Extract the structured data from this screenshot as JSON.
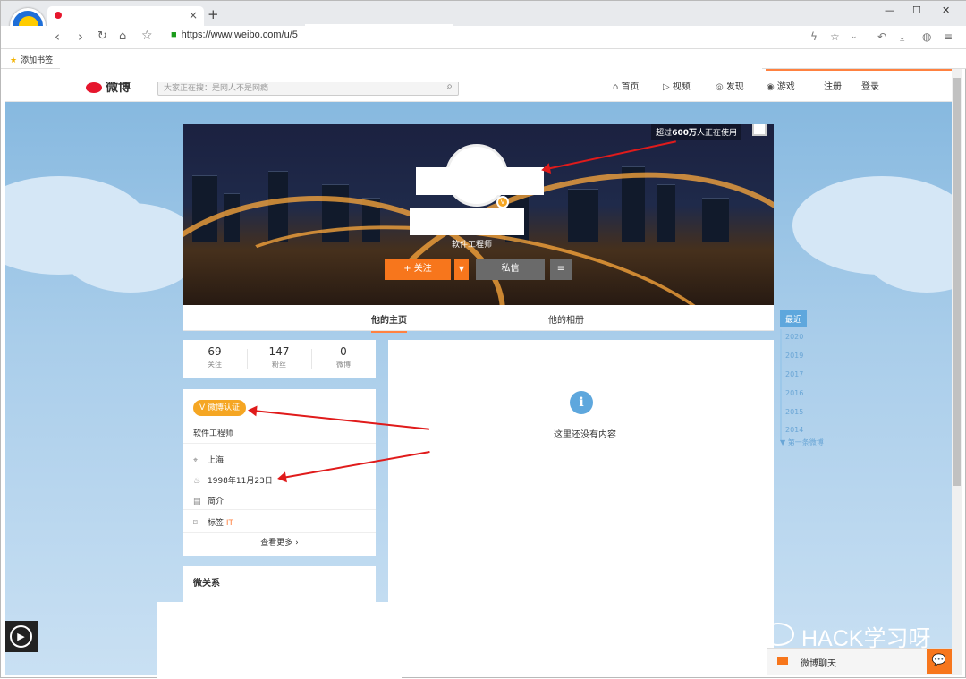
{
  "browser": {
    "url": "https://www.weibo.com/u/5",
    "new_tab_symbol": "+",
    "close_tab_symbol": "×",
    "bookmark_label": "添加书签",
    "window_controls": [
      "—",
      "☐",
      "✕"
    ]
  },
  "weibo_nav": {
    "logo_text": "微博",
    "search_placeholder": "大家正在搜：是网人不是网瘾",
    "links": [
      {
        "label": "首页",
        "icon": "home-icon"
      },
      {
        "label": "视频",
        "icon": "video-icon"
      },
      {
        "label": "发现",
        "icon": "discover-icon"
      },
      {
        "label": "游戏",
        "icon": "game-icon"
      }
    ],
    "register": "注册",
    "login": "登录"
  },
  "cover": {
    "user_count_prefix": "超过",
    "user_count_value": "600万",
    "user_count_suffix": "人正在使用",
    "occupation": "软件工程师",
    "follow_button": "+ 关注",
    "dropdown_symbol": "▼",
    "message_button": "私信",
    "menu_symbol": "≡",
    "verified_symbol": "v"
  },
  "tabs": {
    "home": "他的主页",
    "album": "他的相册"
  },
  "stats": [
    {
      "value": "69",
      "label": "关注"
    },
    {
      "value": "147",
      "label": "粉丝"
    },
    {
      "value": "0",
      "label": "微博"
    }
  ],
  "profile_info": {
    "verification_badge": "V 微博认证",
    "title": "软件工程师",
    "location": "上海",
    "birthday": "1998年11月23日",
    "bio_label": "简介:",
    "tags_label": "标签",
    "tags_value": "IT",
    "see_more": "查看更多 ›"
  },
  "relations": {
    "heading": "微关系"
  },
  "feed": {
    "empty_message": "这里还没有内容",
    "info_symbol": "i"
  },
  "timeline": {
    "current": "最近",
    "years": [
      "2020",
      "2019",
      "2017",
      "2016",
      "2015",
      "2014"
    ],
    "first_post": "▼ 第一条微博"
  },
  "chat": {
    "label": "微博聊天",
    "bubble_symbol": "💬"
  },
  "watermark": {
    "text": "HACK学习呀"
  },
  "colors": {
    "accent": "#ff8140",
    "follow": "#f7761c",
    "badge": "#f5a623",
    "arrow": "#e01b1b"
  }
}
